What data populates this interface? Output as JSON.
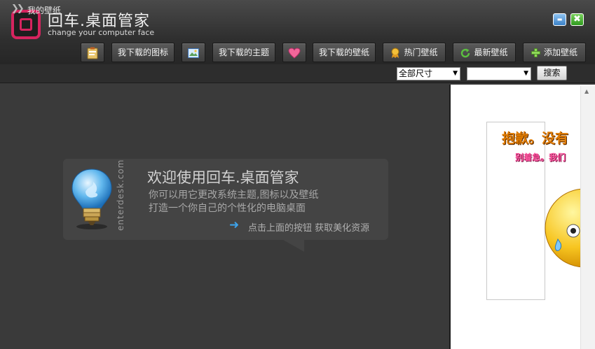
{
  "app": {
    "title": "回车.桌面管家",
    "subtitle": "change your computer face"
  },
  "window_controls": {
    "minimize": "▬",
    "close": "✖"
  },
  "toolbar": {
    "my_icons": "我下载的图标",
    "my_themes": "我下载的主题",
    "my_wallpapers": "我下载的壁纸",
    "hot_wallpapers": "热门壁纸",
    "new_wallpapers": "最新壁纸",
    "add_wallpaper": "添加壁纸"
  },
  "nav": {
    "breadcrumb": "我的壁纸",
    "size_select": {
      "selected": "全部尺寸"
    },
    "category_select": {
      "selected": ""
    },
    "search_label": "搜索"
  },
  "welcome": {
    "title": "欢迎使用回车.桌面管家",
    "line1": "你可以用它更改系统主题,图标以及壁纸",
    "line2": "打造一个你自己的个性化的电脑桌面",
    "hint": "点击上面的按钮 获取美化资源",
    "brand": "enterdesk.com"
  },
  "preview": {
    "error_title": "抱歉。没有",
    "error_sub": "别着急。我们"
  },
  "colors": {
    "brand": "#d6245f",
    "accent_arrow": "#3da2ea"
  },
  "icons": [
    "clipboard-icon",
    "image-edit-icon",
    "heart-icon",
    "award-icon",
    "refresh-icon",
    "plus-icon",
    "lightbulb-icon",
    "double-chevron-icon"
  ]
}
